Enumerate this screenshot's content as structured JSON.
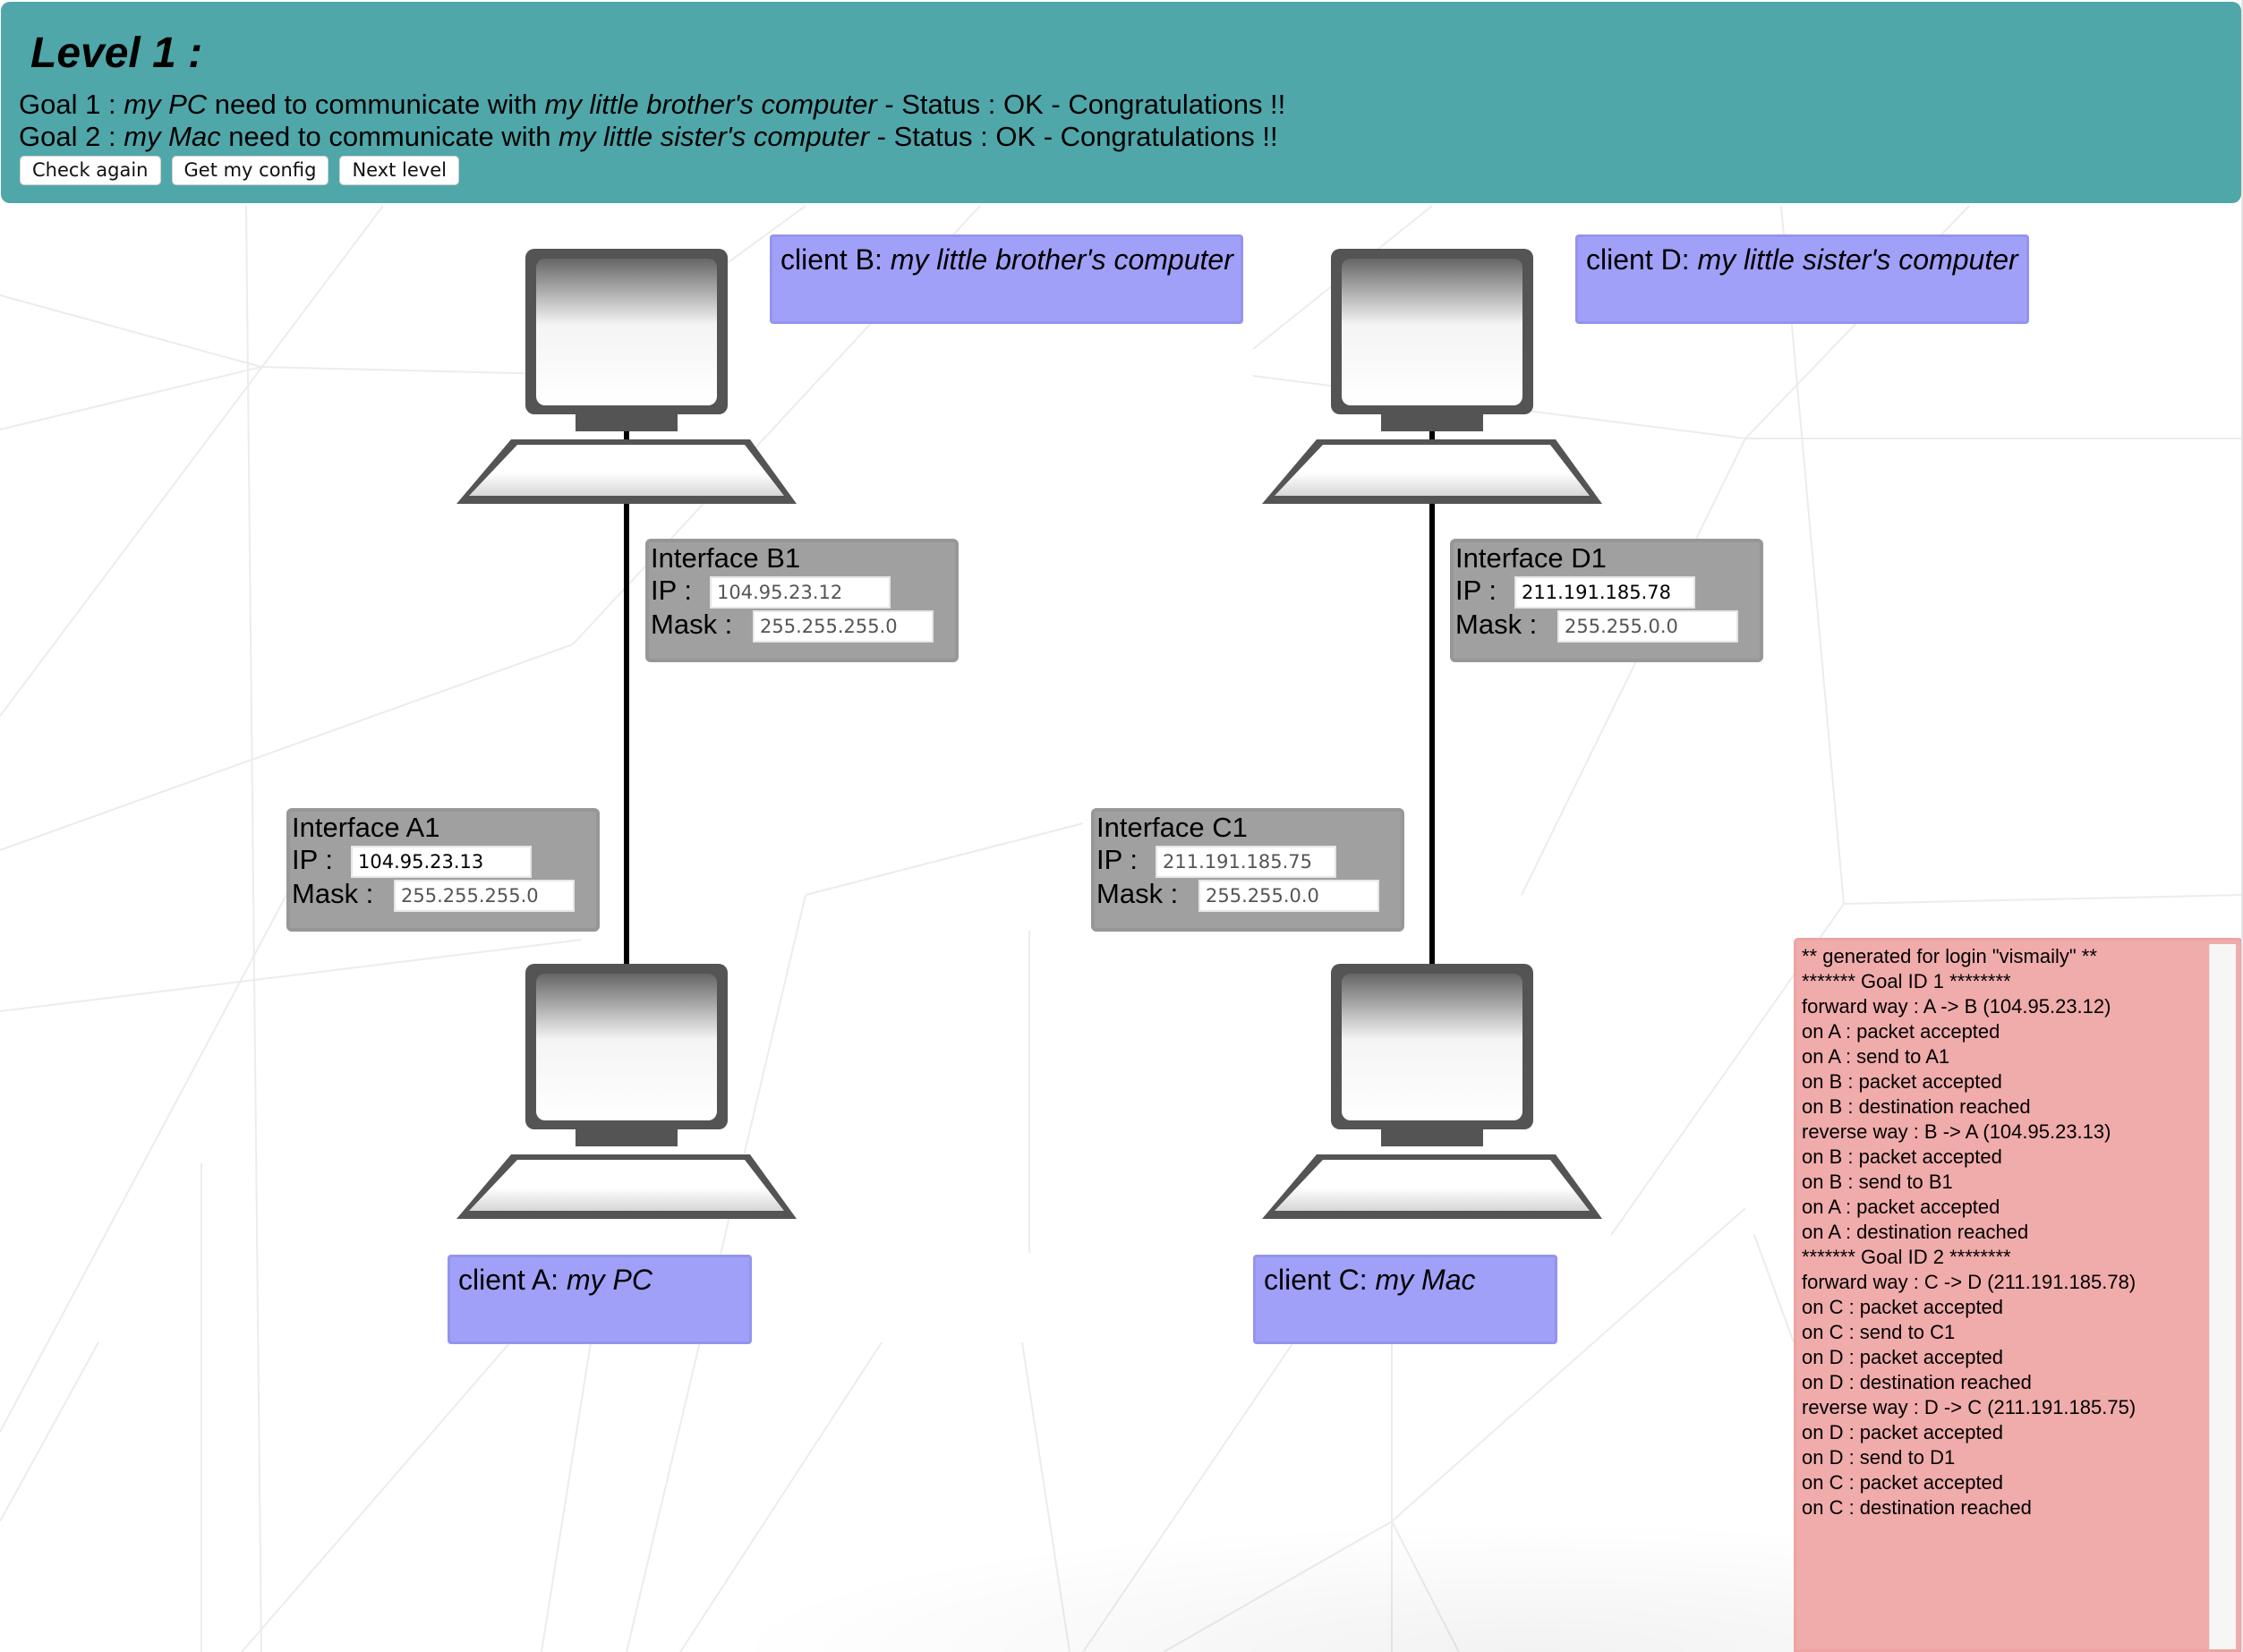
{
  "header": {
    "title": "Level 1 :",
    "goals": [
      {
        "prefix": "Goal 1 : ",
        "source": "my PC",
        "middle": " need to communicate with ",
        "target": "my little brother's computer",
        "status": " - Status : OK - Congratulations !!"
      },
      {
        "prefix": "Goal 2 : ",
        "source": "my Mac",
        "middle": " need to communicate with ",
        "target": "my little sister's computer",
        "status": " - Status : OK - Congratulations !!"
      }
    ],
    "buttons": {
      "check_again": "Check again",
      "get_config": "Get my config",
      "next_level": "Next level"
    }
  },
  "colors": {
    "header_bg": "#50a7aa",
    "client_label_bg": "#a0a0f8",
    "interface_bg": "#a0a0a0",
    "log_bg": "#f0abab",
    "link": "#000000",
    "computer": "#545454"
  },
  "clients": {
    "A": {
      "prefix": "client A: ",
      "name": "my PC"
    },
    "B": {
      "prefix": "client B: ",
      "name": "my little brother's computer"
    },
    "C": {
      "prefix": "client C: ",
      "name": "my Mac"
    },
    "D": {
      "prefix": "client D: ",
      "name": "my little sister's computer"
    }
  },
  "interfaces": {
    "A1": {
      "title": "Interface A1",
      "ip_label": "IP :",
      "mask_label": "Mask :",
      "ip": "104.95.23.13",
      "mask": "255.255.255.0"
    },
    "B1": {
      "title": "Interface B1",
      "ip_label": "IP :",
      "mask_label": "Mask :",
      "ip": "104.95.23.12",
      "mask": "255.255.255.0"
    },
    "C1": {
      "title": "Interface C1",
      "ip_label": "IP :",
      "mask_label": "Mask :",
      "ip": "211.191.185.75",
      "mask": "255.255.0.0"
    },
    "D1": {
      "title": "Interface D1",
      "ip_label": "IP :",
      "mask_label": "Mask :",
      "ip": "211.191.185.78",
      "mask": "255.255.0.0"
    }
  },
  "log": {
    "lines": [
      "** generated for login \"vismaily\" **",
      "******* Goal ID 1 ********",
      "forward way : A -> B (104.95.23.12)",
      "on A : packet accepted",
      "on A : send to A1",
      "on B : packet accepted",
      "on B : destination reached",
      "reverse way : B -> A (104.95.23.13)",
      "on B : packet accepted",
      "on B : send to B1",
      "on A : packet accepted",
      "on A : destination reached",
      "******* Goal ID 2 ********",
      "forward way : C -> D (211.191.185.78)",
      "on C : packet accepted",
      "on C : send to C1",
      "on D : packet accepted",
      "on D : destination reached",
      "reverse way : D -> C (211.191.185.75)",
      "on D : packet accepted",
      "on D : send to D1",
      "on C : packet accepted",
      "on C : destination reached"
    ]
  }
}
